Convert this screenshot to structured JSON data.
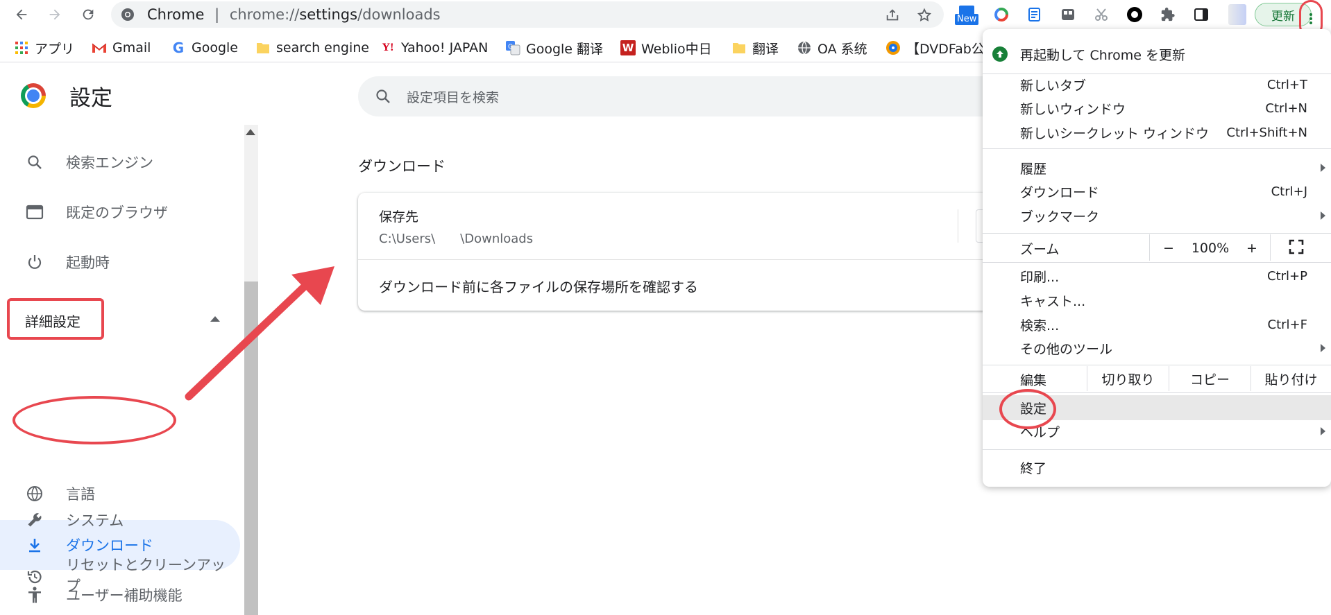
{
  "omnibox": {
    "site": "Chrome",
    "sep": "|",
    "url_scheme": "chrome://",
    "url_host": "settings",
    "url_path": "/downloads"
  },
  "toolbar": {
    "update_label": "更新",
    "new_badge": "New"
  },
  "bookmarks": [
    {
      "label": "アプリ",
      "icon": "apps-grid-icon"
    },
    {
      "label": "Gmail",
      "icon": "gmail-icon"
    },
    {
      "label": "Google",
      "icon": "google-g-icon"
    },
    {
      "label": "search engine",
      "icon": "folder-icon"
    },
    {
      "label": "Yahoo! JAPAN",
      "icon": "yahoo-icon"
    },
    {
      "label": "Google 翻译",
      "icon": "google-translate-icon"
    },
    {
      "label": "Weblio中日",
      "icon": "weblio-icon"
    },
    {
      "label": "翻译",
      "icon": "folder-icon"
    },
    {
      "label": "OA 系统",
      "icon": "globe-icon"
    },
    {
      "label": "【DVDFab公",
      "icon": "dvdfab-icon"
    }
  ],
  "settings": {
    "title": "設定",
    "search_placeholder": "設定項目を検索"
  },
  "sidebar": {
    "items": [
      {
        "label": "検索エンジン",
        "icon": "search-icon"
      },
      {
        "label": "既定のブラウザ",
        "icon": "browser-window-icon"
      },
      {
        "label": "起動時",
        "icon": "power-icon"
      }
    ],
    "advanced_label": "詳細設定",
    "advanced_items": [
      {
        "label": "言語",
        "icon": "globe-icon"
      },
      {
        "label": "ダウンロード",
        "icon": "download-icon",
        "active": true
      },
      {
        "label": "ユーザー補助機能",
        "icon": "accessibility-icon"
      },
      {
        "label": "システム",
        "icon": "wrench-icon"
      },
      {
        "label": "リセットとクリーンアップ",
        "icon": "restore-icon"
      }
    ]
  },
  "main": {
    "section_title": "ダウンロード",
    "location_label": "保存先",
    "location_path": "C:\\Users\\　　\\Downloads",
    "ask_label": "ダウンロード前に各ファイルの保存場所を確認する"
  },
  "menu": {
    "relaunch": "再起動して Chrome を更新",
    "new_tab": {
      "label": "新しいタブ",
      "shortcut": "Ctrl+T"
    },
    "new_window": {
      "label": "新しいウィンドウ",
      "shortcut": "Ctrl+N"
    },
    "incognito": {
      "label": "新しいシークレット ウィンドウ",
      "shortcut": "Ctrl+Shift+N"
    },
    "history": {
      "label": "履歴"
    },
    "downloads": {
      "label": "ダウンロード",
      "shortcut": "Ctrl+J"
    },
    "bookmarks": {
      "label": "ブックマーク"
    },
    "zoom": {
      "label": "ズーム",
      "minus": "−",
      "value": "100%",
      "plus": "+"
    },
    "print": {
      "label": "印刷...",
      "shortcut": "Ctrl+P"
    },
    "cast": {
      "label": "キャスト..."
    },
    "find": {
      "label": "検索...",
      "shortcut": "Ctrl+F"
    },
    "more_tools": {
      "label": "その他のツール"
    },
    "edit": {
      "label": "編集",
      "cut": "切り取り",
      "copy": "コピー",
      "paste": "貼り付け"
    },
    "settings": {
      "label": "設定"
    },
    "help": {
      "label": "ヘルプ"
    },
    "exit": {
      "label": "終了"
    }
  },
  "colors": {
    "accent": "#1a73e8",
    "annotation_red": "#e8474f",
    "update_green": "#188038"
  }
}
